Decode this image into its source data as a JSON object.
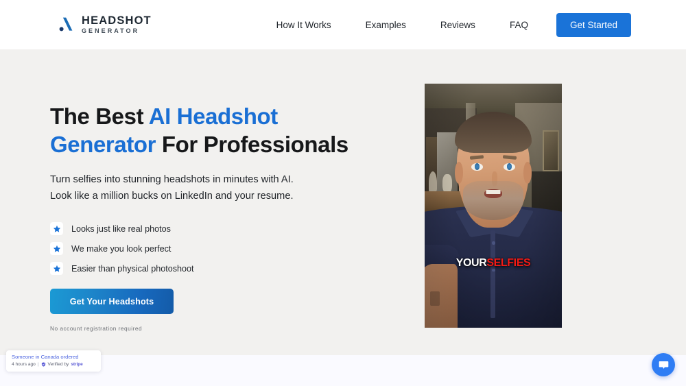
{
  "brand": {
    "logo_icon": "logo-slash-mark",
    "name_line1": "HEADSHOT",
    "name_line2": "GENERATOR",
    "accent_color": "#1a6fd4",
    "logo_color": "#1b6cb5"
  },
  "header": {
    "nav": [
      {
        "label": "How It Works",
        "name": "nav-how-it-works"
      },
      {
        "label": "Examples",
        "name": "nav-examples"
      },
      {
        "label": "Reviews",
        "name": "nav-reviews"
      },
      {
        "label": "FAQ",
        "name": "nav-faq"
      }
    ],
    "cta_label": "Get Started",
    "cta_color": "#1a73d8"
  },
  "hero": {
    "headline": {
      "part1": "The Best ",
      "accent1": "AI Headshot Generator",
      "part2": " For Professionals"
    },
    "subhead_line1": "Turn selfies into stunning headshots in minutes with AI.",
    "subhead_line2": "Look like a million bucks on LinkedIn and your resume.",
    "features": [
      {
        "label": "Looks just like real photos",
        "icon": "star-icon"
      },
      {
        "label": "We make you look perfect",
        "icon": "star-icon"
      },
      {
        "label": "Easier than physical photoshoot",
        "icon": "star-icon"
      }
    ],
    "cta_label": "Get Your Headshots",
    "cta_note": "No account registration required",
    "background_color": "#f2f1ef"
  },
  "media": {
    "caption_word1": "YOUR",
    "caption_word2": "SELFIES",
    "caption_color1": "#ffffff",
    "caption_color2": "#f21b16",
    "alt": "Man in navy polo shirt speaking to camera in a home interior"
  },
  "toast": {
    "title": "Someone in Canada ordered",
    "time": "4 hours ago",
    "separator": "|",
    "verified_label": "Verified by",
    "verified_brand": "stripe",
    "shield_icon": "shield-check-icon"
  },
  "chat": {
    "icon": "chat-bubble-icon",
    "color": "#2f7df4"
  }
}
